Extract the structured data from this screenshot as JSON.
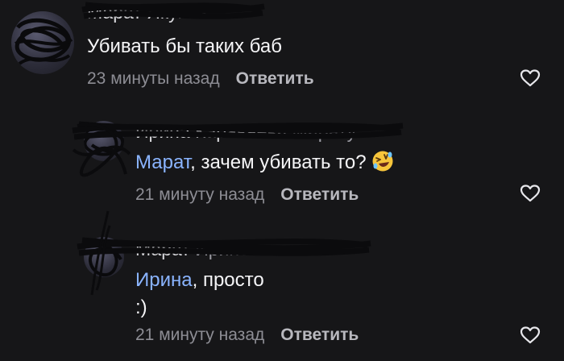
{
  "comments": [
    {
      "author": "Марат Якупов",
      "text": "Убивать бы таких баб",
      "time": "23 минуты назад",
      "reply_label": "Ответить"
    },
    {
      "author": "Ирина Караваева",
      "reply_to": "Марату",
      "mention": "Марат",
      "text": ", зачем убивать то?",
      "emoji": "rolling-on-floor-laughing",
      "time": "21 минуту назад",
      "reply_label": "Ответить"
    },
    {
      "author": "Марат",
      "reply_to": "Ирине",
      "mention": "Ирина",
      "text": ", просто",
      "text_line2": ":)",
      "time": "21 минуту назад",
      "reply_label": "Ответить"
    }
  ],
  "icons": {
    "like": "heart-outline-icon"
  },
  "colors": {
    "background": "#161618",
    "mention": "#8ab4ff",
    "muted": "#8d8d94"
  }
}
